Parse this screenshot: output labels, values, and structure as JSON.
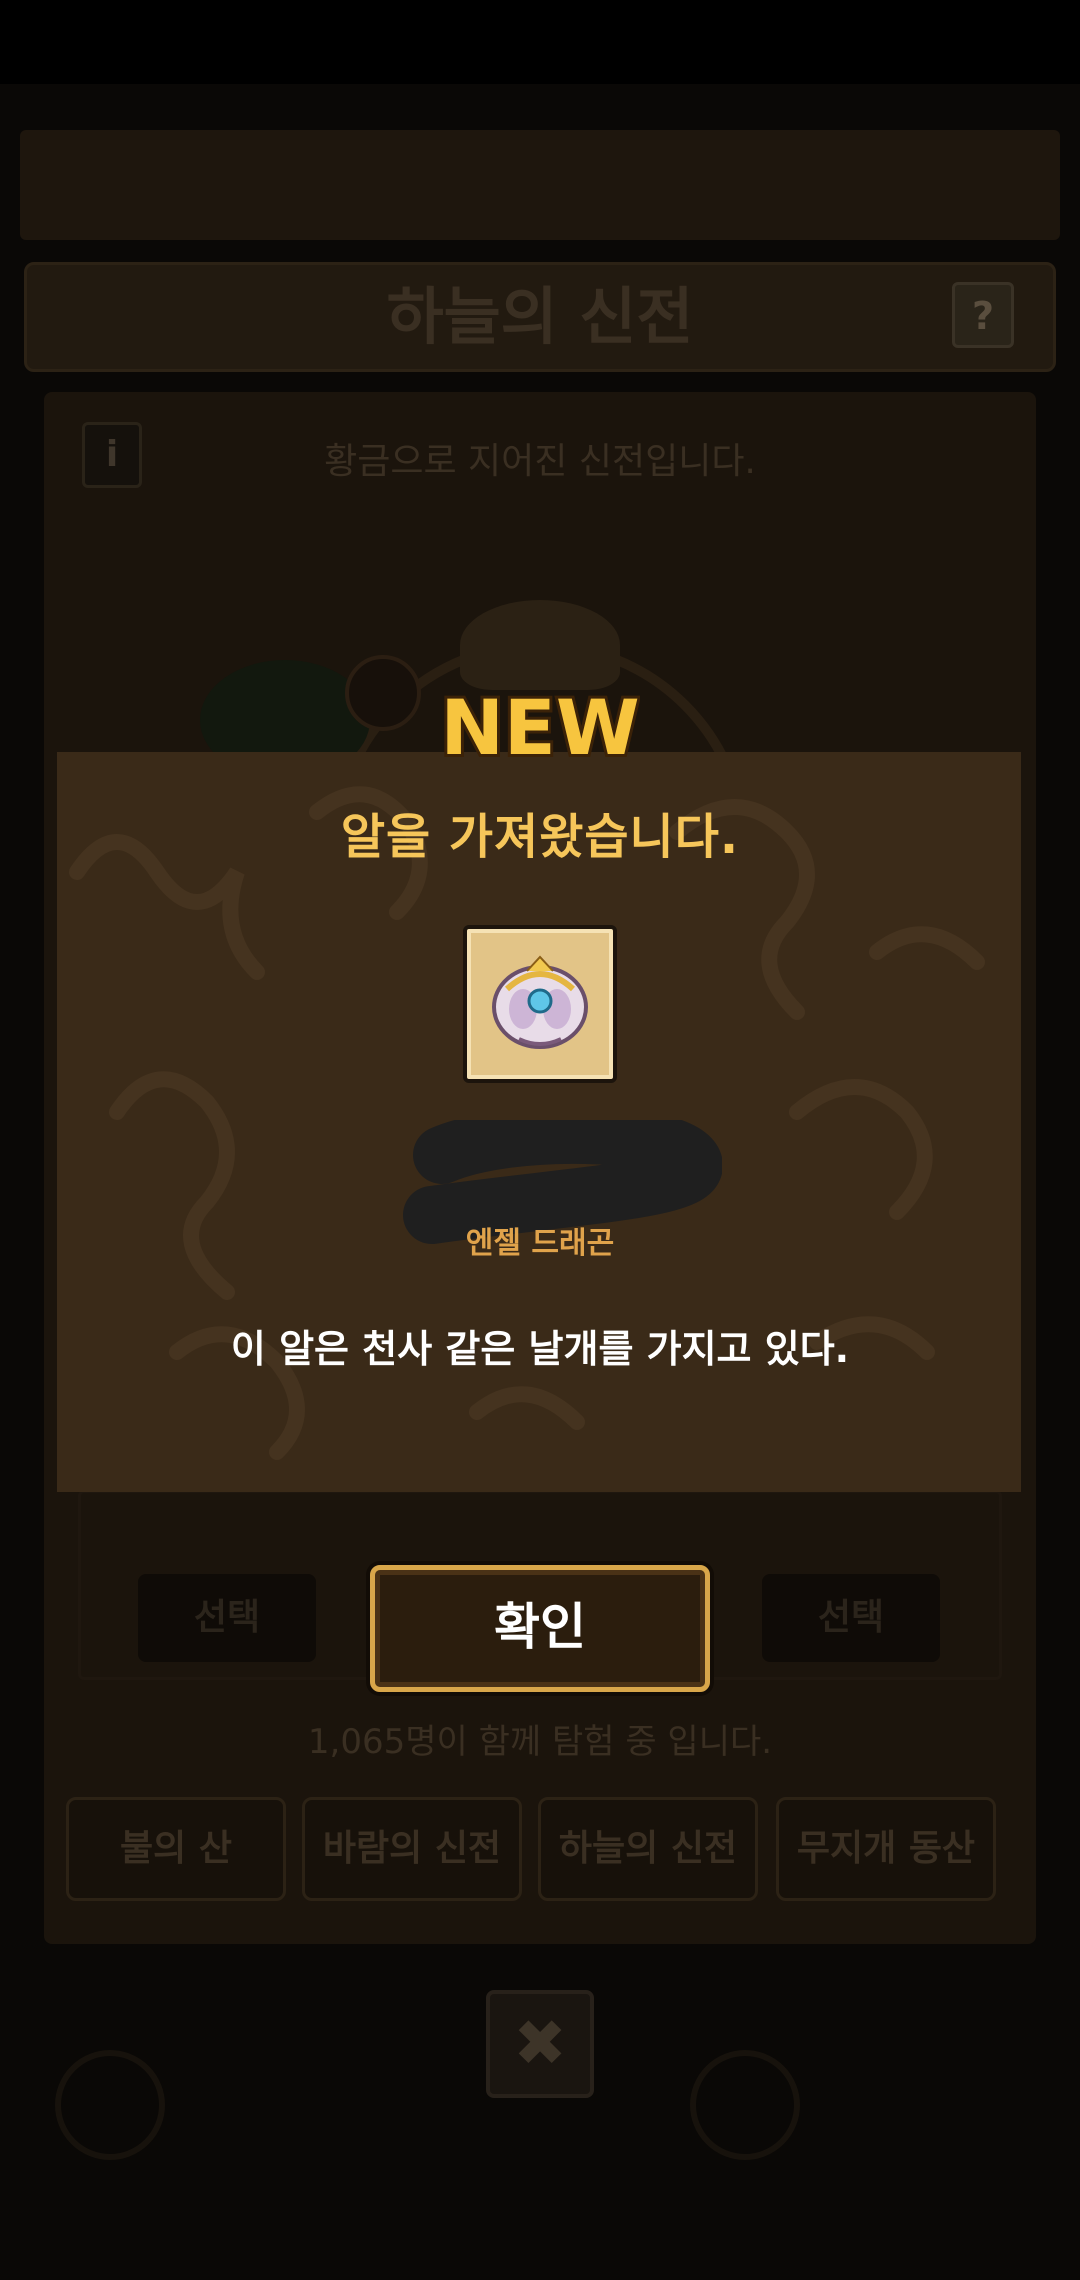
{
  "background": {
    "header_title": "하늘의 신전",
    "help_label": "?",
    "info_label": "i",
    "description": "황금으로 지어진 신전입니다.",
    "select_left": "선택",
    "select_right": "선택",
    "together_text": "1,065명이 함께 탐험 중 입니다.",
    "tabs": [
      "불의 산",
      "바람의 신전",
      "하늘의 신전",
      "무지개 동산"
    ],
    "close_label": "✖"
  },
  "modal": {
    "badge": "NEW",
    "title": "알을 가져왔습니다.",
    "egg_name": "엔젤 드래곤",
    "egg_description": "이 알은 천사 같은 날개를 가지고 있다.",
    "confirm_label": "확인",
    "egg_icon": "angel-dragon-egg-icon"
  },
  "colors": {
    "title": "#f6c65a",
    "egg_name": "#e0a34b",
    "modal_bg": "#3a2a18",
    "confirm_border": "#d8a64a"
  }
}
